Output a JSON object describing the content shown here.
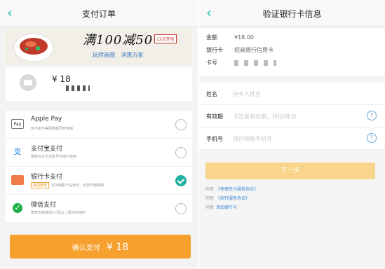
{
  "left": {
    "title": "支付订单",
    "banner": {
      "headline": "满100减50",
      "tag": "12点开抢",
      "sub_line": [
        "玩转商圈",
        "消惠万家"
      ]
    },
    "order": {
      "amount": "¥ 18"
    },
    "methods": [
      {
        "name": "Apple Pay",
        "desc": "暂不能与美团券额同时使用",
        "icon": "Pay",
        "badge": "",
        "selected": false
      },
      {
        "name": "支付宝支付",
        "desc": "推荐有支付宝账号的用户使用",
        "icon": "支",
        "badge": "",
        "selected": false
      },
      {
        "name": "银行卡支付",
        "desc": "支持储蓄卡信用卡，无需开通网银",
        "icon": "",
        "badge": "美团推荐",
        "selected": true
      },
      {
        "name": "微信支付",
        "desc": "推荐安装微信5.0及以上版本的使用",
        "icon": "✓",
        "badge": "",
        "selected": false
      }
    ],
    "confirm": {
      "label": "确认支付",
      "amount": "¥ 18"
    }
  },
  "right": {
    "title": "验证银行卡信息",
    "info": {
      "amount_label": "金额",
      "amount_value": "¥18.00",
      "bankcard_label": "银行卡",
      "bankcard_value": "招商银行信用卡",
      "cardno_label": "卡号"
    },
    "form": [
      {
        "label": "姓名",
        "placeholder": "持卡人姓名",
        "help": false
      },
      {
        "label": "有效期",
        "placeholder": "卡正面有效期，月份/年份",
        "help": true
      },
      {
        "label": "手机号",
        "placeholder": "银行预留手机号",
        "help": true
      }
    ],
    "next_label": "下一步",
    "agreements": [
      {
        "prefix": "同意",
        "link": "《快捷支付服务协议》"
      },
      {
        "prefix": "同意",
        "link": "《招行服务协议》"
      },
      {
        "prefix": "同意",
        "link": "添加银行卡"
      }
    ]
  },
  "colors": {
    "accent": "#1dbdab",
    "confirm": "#f6a02d",
    "next_disabled": "#f9d58b",
    "selected_radio": "#21b1a2",
    "link": "#3a8ad6"
  }
}
